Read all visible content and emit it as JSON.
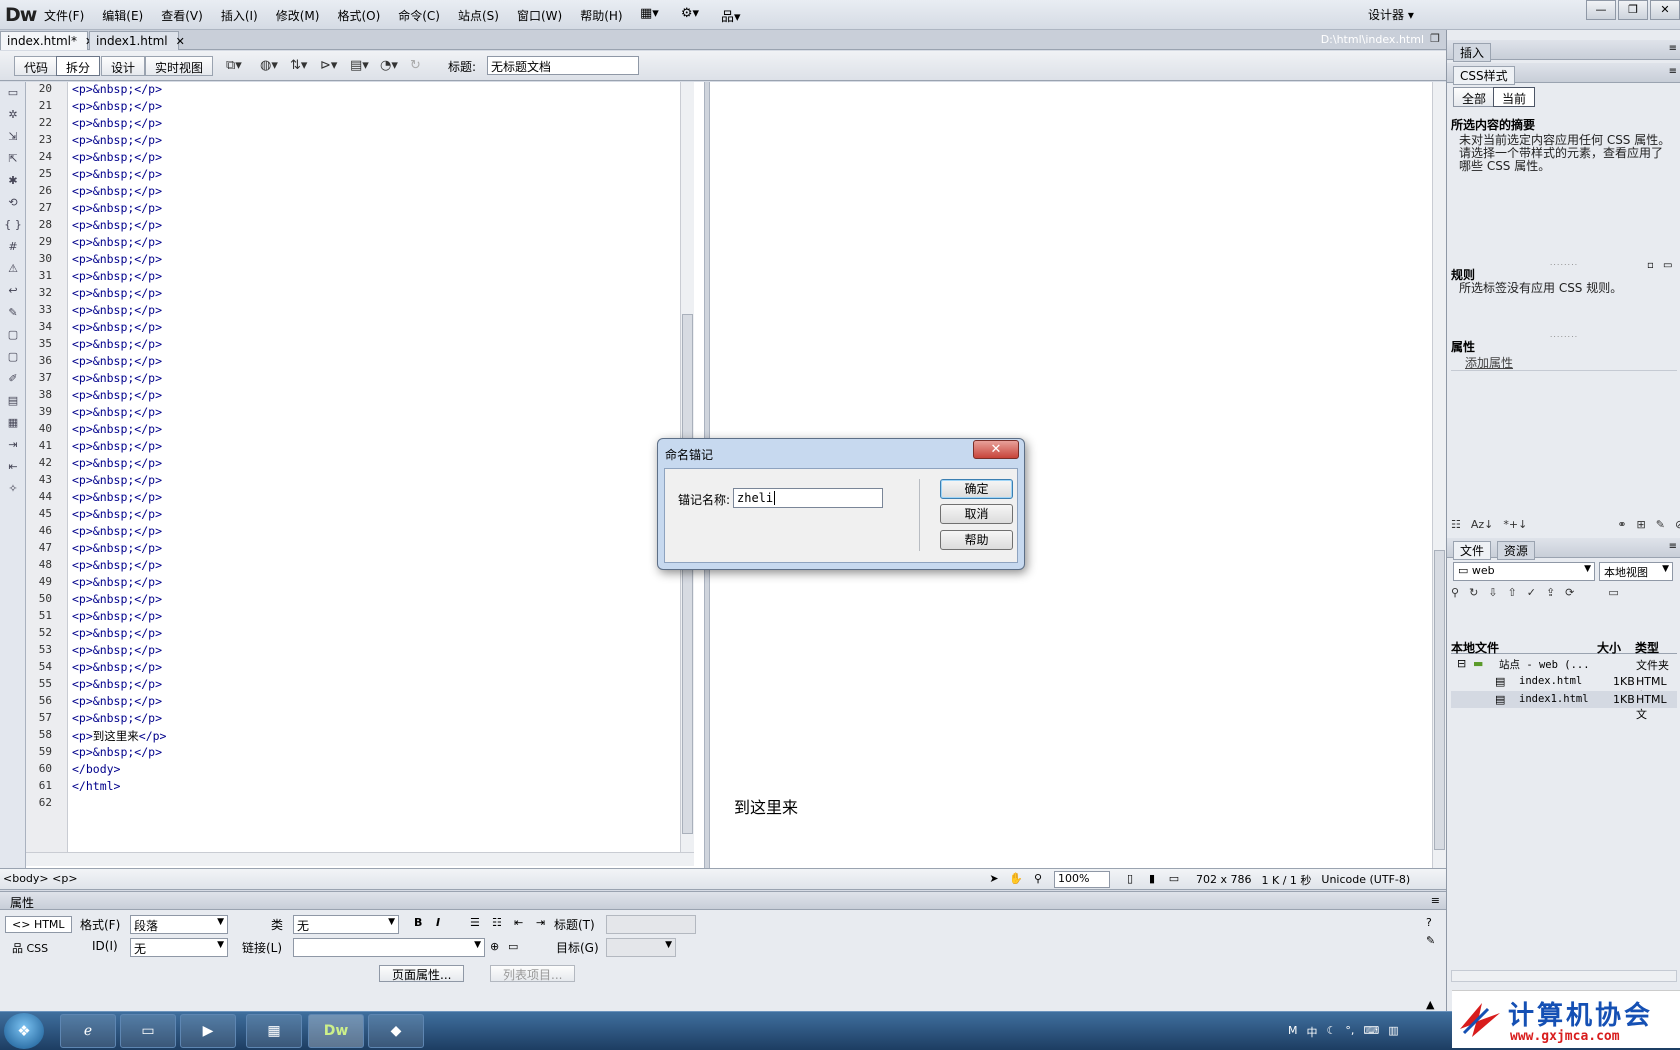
{
  "app": {
    "logo": "Dw",
    "workspace": "设计器"
  },
  "menu": [
    "文件(F)",
    "编辑(E)",
    "查看(V)",
    "插入(I)",
    "修改(M)",
    "格式(O)",
    "命令(C)",
    "站点(S)",
    "窗口(W)",
    "帮助(H)"
  ],
  "tabs": [
    {
      "label": "index.html*",
      "close": "✕"
    },
    {
      "label": "index1.html",
      "close": "✕"
    }
  ],
  "doc_path": "D:\\html\\index.html",
  "view_buttons": [
    "代码",
    "拆分",
    "设计",
    "实时视图"
  ],
  "title_label": "标题:",
  "title_value": "无标题文档",
  "code": {
    "line_numbers": [
      "20",
      "21",
      "22",
      "23",
      "24",
      "25",
      "26",
      "27",
      "28",
      "29",
      "30",
      "31",
      "32",
      "33",
      "34",
      "35",
      "36",
      "37",
      "38",
      "39",
      "40",
      "41",
      "42",
      "43",
      "44",
      "45",
      "46",
      "47",
      "48",
      "49",
      "50",
      "51",
      "52",
      "53",
      "54",
      "55",
      "56",
      "57",
      "58",
      "59",
      "60",
      "61",
      "62"
    ],
    "nbsp_line": "<p>&nbsp;</p>",
    "line58_open": "<p>",
    "line58_text": "到这里来",
    "line58_close": "</p>",
    "body_close": "</body>",
    "html_close": "</html>"
  },
  "design_text": "到这里来",
  "status": {
    "tag_selector": "<body> <p>",
    "zoom": "100%",
    "window_size": "702 x 786",
    "download": "1 K / 1 秒",
    "encoding": "Unicode (UTF-8)"
  },
  "properties": {
    "header": "属性",
    "html_btn": "HTML",
    "css_btn": "CSS",
    "format_label": "格式(F)",
    "format_value": "段落",
    "class_label": "类",
    "class_value": "无",
    "id_label": "ID(I)",
    "id_value": "无",
    "link_label": "链接(L)",
    "heading_label": "标题(T)",
    "target_label": "目标(G)",
    "bold": "B",
    "italic": "I",
    "page_props_btn": "页面属性...",
    "list_item_btn": "列表项目..."
  },
  "right": {
    "insert_header": "插入",
    "css_header": "CSS样式",
    "css_tab_all": "全部",
    "css_tab_current": "当前",
    "summary_title": "所选内容的摘要",
    "summary_text": "未对当前选定内容应用任何 CSS 属性。请选择一个带样式的元素，查看应用了哪些 CSS 属性。",
    "rules_title": "规则",
    "rules_text": "所选标签没有应用 CSS 规则。",
    "props_title": "属性",
    "add_prop": "添加属性",
    "files_tab": "文件",
    "assets_tab": "资源",
    "site_select": "web",
    "view_select": "本地视图",
    "col_local": "本地文件",
    "col_size": "大小",
    "col_type": "类型",
    "files": [
      {
        "name": "站点 - web (...",
        "size": "",
        "type": "文件夹"
      },
      {
        "name": "index.html",
        "size": "1KB",
        "type": "HTML 文"
      },
      {
        "name": "index1.html",
        "size": "1KB",
        "type": "HTML 文"
      }
    ]
  },
  "dialog": {
    "title": "命名锚记",
    "close": "✕",
    "label": "锚记名称:",
    "value": "zheli",
    "ok": "确定",
    "cancel": "取消",
    "help": "帮助"
  },
  "taskbar": {
    "tray": [
      "中",
      "☾",
      "°,"
    ]
  },
  "watermark": {
    "text": "计算机协会",
    "url": "www.gxjmca.com"
  }
}
